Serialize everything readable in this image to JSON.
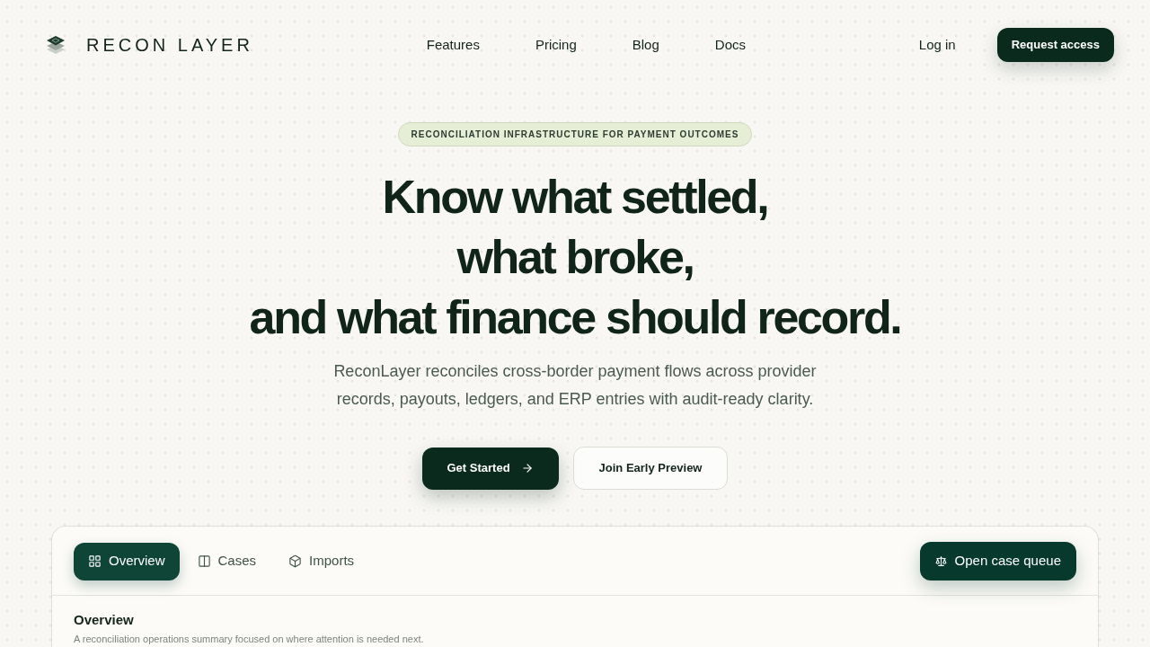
{
  "header": {
    "brand": "RECON LAYER",
    "nav": [
      {
        "label": "Features"
      },
      {
        "label": "Pricing"
      },
      {
        "label": "Blog"
      },
      {
        "label": "Docs"
      }
    ],
    "login": "Log in",
    "cta": "Request access"
  },
  "hero": {
    "badge": "RECONCILIATION INFRASTRUCTURE FOR PAYMENT OUTCOMES",
    "headline": [
      "Know what settled,",
      "what broke,",
      "and what finance should record."
    ],
    "description": "ReconLayer reconciles cross-border payment flows across provider records, payouts, ledgers, and ERP entries with audit-ready clarity.",
    "buttons": [
      {
        "label": "Get Started",
        "kind": "primary"
      },
      {
        "label": "Join Early Preview",
        "kind": "secondary"
      }
    ]
  },
  "preview": {
    "tabs": [
      {
        "label": "Overview",
        "selected": true
      },
      {
        "label": "Cases",
        "selected": false
      },
      {
        "label": "Imports",
        "selected": false
      }
    ],
    "action": "Open case queue",
    "section": {
      "title": "Overview",
      "subtitle": "A reconciliation operations summary focused on where attention is needed next."
    }
  }
}
